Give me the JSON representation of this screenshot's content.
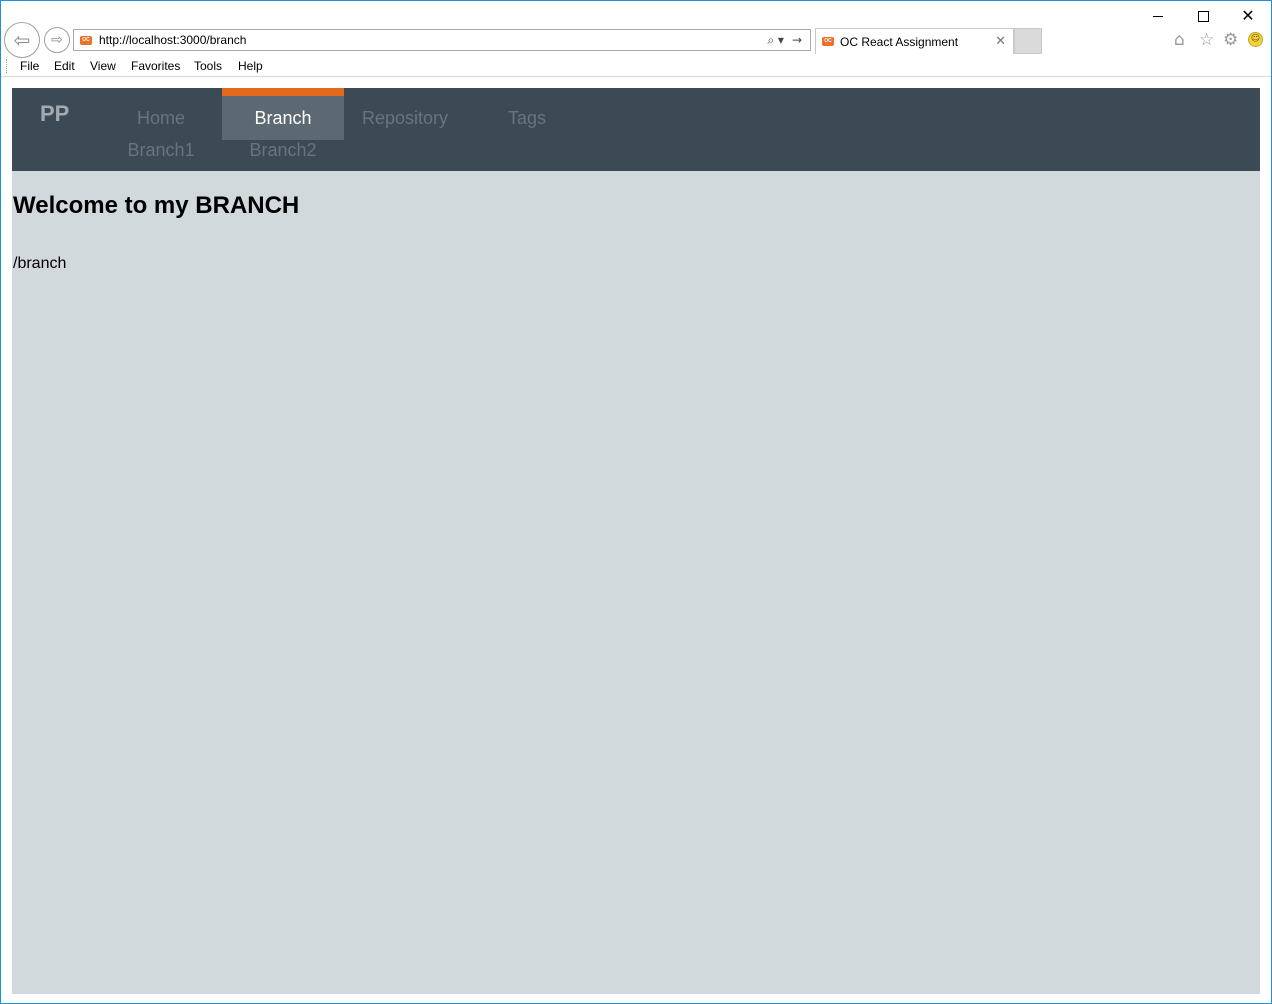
{
  "browser": {
    "url": "http://localhost:3000/branch",
    "tab_title": "OC React Assignment",
    "favicon_text": "OC",
    "close_glyph": "✕",
    "back_glyph": "⇦",
    "forward_glyph": "⇨",
    "search_glyph": "⌕ ▾",
    "go_glyph": "→",
    "home_glyph": "⌂",
    "star_glyph": "☆",
    "gear_glyph": "⚙",
    "smiley_glyph": "☺",
    "menu": [
      "File",
      "Edit",
      "View",
      "Favorites",
      "Tools",
      "Help"
    ]
  },
  "site": {
    "logo": "PP",
    "nav": [
      "Home",
      "Branch",
      "Repository",
      "Tags"
    ],
    "active_nav": "Branch",
    "sub_nav": [
      "Branch1",
      "Branch2"
    ],
    "accent_color": "#e36a1c"
  },
  "content": {
    "heading": "Welcome to my BRANCH",
    "route": "/branch"
  }
}
